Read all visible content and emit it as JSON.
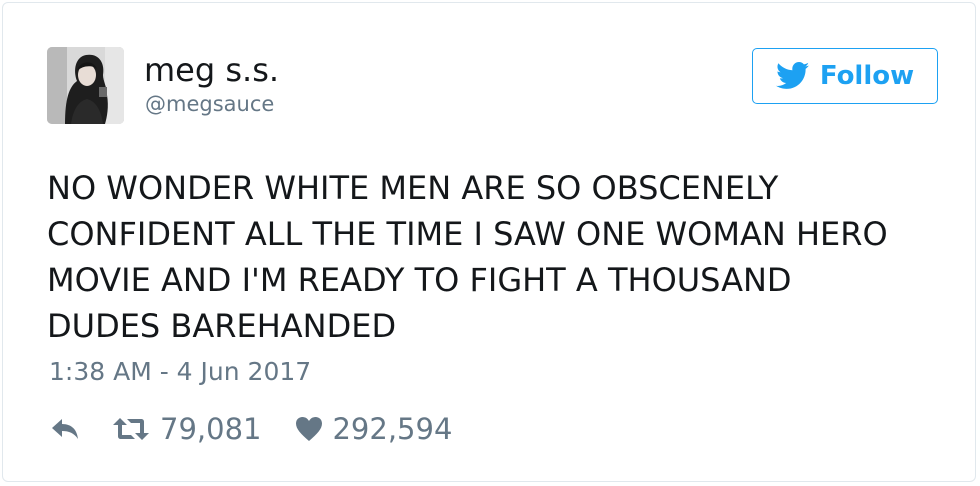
{
  "user": {
    "display_name": "meg s.s.",
    "handle": "@megsauce"
  },
  "follow_button": {
    "label": "Follow",
    "icon": "twitter-bird-icon"
  },
  "tweet": {
    "text_lines": [
      "NO WONDER WHITE MEN ARE SO OBSCENELY",
      "CONFIDENT ALL THE TIME I SAW ONE WOMAN HERO",
      "MOVIE AND I'M READY TO FIGHT A THOUSAND",
      "DUDES BAREHANDED"
    ],
    "timestamp": "1:38 AM - 4 Jun 2017"
  },
  "actions": {
    "reply": {
      "icon": "reply-icon"
    },
    "retweet": {
      "icon": "retweet-icon",
      "count": "79,081"
    },
    "like": {
      "icon": "heart-icon",
      "count": "292,594"
    }
  },
  "colors": {
    "accent": "#1da1f2",
    "text_primary": "#14171a",
    "text_secondary": "#657786",
    "border": "#e1e8ed"
  }
}
